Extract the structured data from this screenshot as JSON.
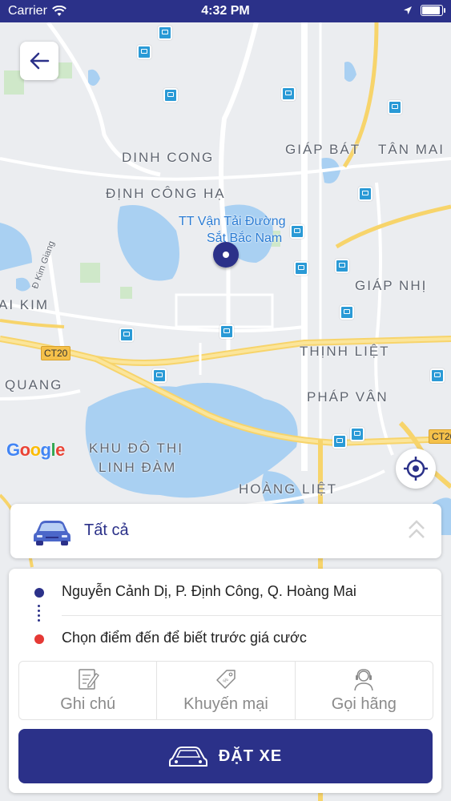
{
  "status_bar": {
    "carrier": "Carrier",
    "time": "4:32 PM"
  },
  "map": {
    "labels": {
      "dinh_cong": "DINH CONG",
      "dinh_cong_ha": "ĐỊNH CÔNG HẠ",
      "giap_bat": "GIÁP BÁT",
      "tan_mai": "TÂN MAI",
      "giap_nhi": "GIÁP NHỊ",
      "thinh_liet": "THỊNH LIỆT",
      "phap_van": "PHÁP VÂN",
      "hoang_liet": "HOÀNG LIỆT",
      "quang": "QUANG",
      "ai_kim": "AI KIM",
      "khu_do_thi": "KHU ĐÔ THỊ",
      "linh_dam": "LINH ĐÀM",
      "kim_giang": "Đ Kim Giang",
      "poi_line1": "TT Vận Tải Đường",
      "poi_line2": "Sắt Bắc Nam",
      "ct20_left": "CT20",
      "ct20_right": "CT20"
    },
    "google": "Google"
  },
  "car_type": {
    "label": "Tất cả"
  },
  "trip": {
    "pickup": "Nguyễn Cảnh Dị, P. Định Công, Q. Hoàng Mai",
    "destination": "Chọn điểm đến để biết trước giá cước"
  },
  "actions": {
    "note": "Ghi chú",
    "promo": "Khuyến mại",
    "call": "Gọi hãng"
  },
  "book_button": {
    "label": "ĐẶT XE"
  },
  "colors": {
    "brand": "#2b3189",
    "pickup_dot": "#2b3189",
    "destination_dot": "#e53935"
  }
}
